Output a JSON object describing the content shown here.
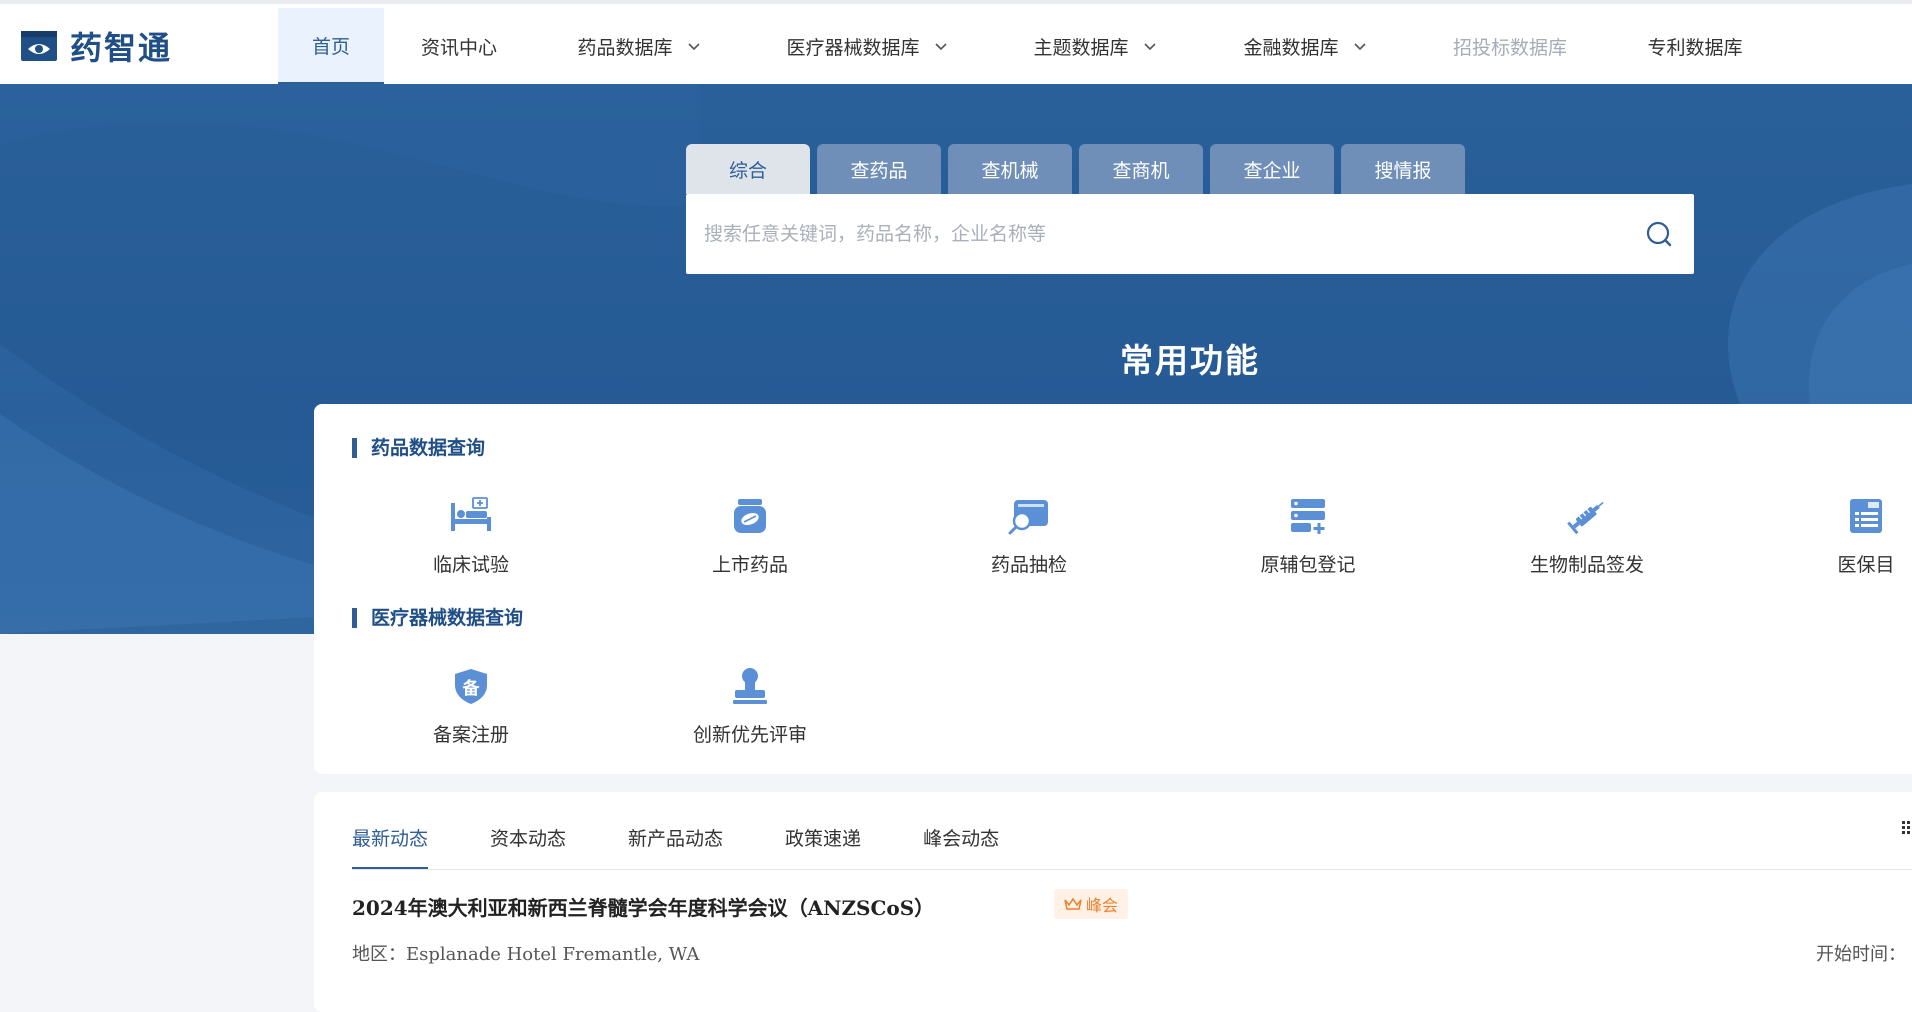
{
  "logo": {
    "text": "药智通"
  },
  "nav": {
    "items": [
      {
        "label": "首页",
        "state": "active"
      },
      {
        "label": "资讯中心"
      },
      {
        "label": "药品数据库",
        "dropdown": true
      },
      {
        "label": "医疗器械数据库",
        "dropdown": true
      },
      {
        "label": "主题数据库",
        "dropdown": true
      },
      {
        "label": "金融数据库",
        "dropdown": true
      },
      {
        "label": "招投标数据库",
        "state": "disabled"
      },
      {
        "label": "专利数据库"
      }
    ]
  },
  "search": {
    "tabs": [
      "综合",
      "查药品",
      "查机械",
      "查商机",
      "查企业",
      "搜情报"
    ],
    "active_tab": "综合",
    "placeholder": "搜索任意关键词，药品名称，企业名称等",
    "value": ""
  },
  "functions": {
    "title": "常用功能",
    "drug_section": {
      "title": "药品数据查询",
      "items": [
        {
          "label": "临床试验",
          "icon": "hospital-bed-icon"
        },
        {
          "label": "上市药品",
          "icon": "pill-bottle-icon"
        },
        {
          "label": "药品抽检",
          "icon": "inspection-icon"
        },
        {
          "label": "原辅包登记",
          "icon": "registration-list-icon"
        },
        {
          "label": "生物制品签发",
          "icon": "syringe-icon"
        },
        {
          "label": "医保目",
          "icon": "medical-insurance-icon"
        }
      ]
    },
    "device_section": {
      "title": "医疗器械数据查询",
      "items": [
        {
          "label": "备案注册",
          "icon": "shield-record-icon",
          "icon_text": "备"
        },
        {
          "label": "创新优先评审",
          "icon": "stamp-icon"
        }
      ]
    }
  },
  "news": {
    "tabs": [
      "最新动态",
      "资本动态",
      "新产品动态",
      "政策速递",
      "峰会动态"
    ],
    "active_tab": "最新动态",
    "item": {
      "title": "2024年澳大利亚和新西兰脊髓学会年度科学会议（ANZSCoS）",
      "badge": "峰会",
      "region_label": "地区：",
      "region": "Esplanade Hotel Fremantle, WA",
      "start_label": "开始时间："
    }
  },
  "colors": {
    "brand": "#2f5d96",
    "hero": "#255a95",
    "icon": "#5b8fd6",
    "badge": "#f07f2c"
  }
}
